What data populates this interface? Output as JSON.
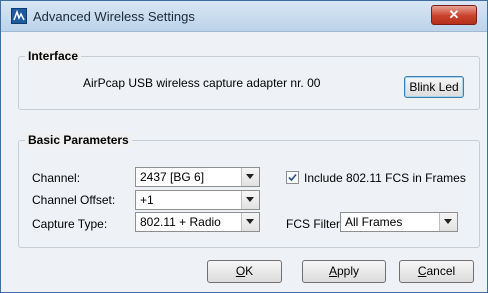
{
  "window": {
    "title": "Advanced Wireless Settings",
    "close_symbol": "✕",
    "icon": "airpcap-app-icon"
  },
  "interface": {
    "group_title": "Interface",
    "adapter_text": "AirPcap USB wireless capture adapter nr. 00",
    "blink_button": "Blink Led"
  },
  "basic": {
    "group_title": "Basic Parameters",
    "channel": {
      "label": "Channel:",
      "value": "2437 [BG 6]"
    },
    "channel_offset": {
      "label": "Channel Offset:",
      "value": "+1"
    },
    "capture_type": {
      "label": "Capture Type:",
      "value": "802.11 + Radio"
    },
    "include_fcs": {
      "label": "Include 802.11 FCS in Frames",
      "checked": true
    },
    "fcs_filter": {
      "label": "FCS Filter:",
      "value": "All Frames"
    }
  },
  "buttons": {
    "ok_mnemonic": "O",
    "ok_rest": "K",
    "apply_mnemonic": "A",
    "apply_rest": "pply",
    "cancel_mnemonic": "C",
    "cancel_rest": "ancel"
  }
}
